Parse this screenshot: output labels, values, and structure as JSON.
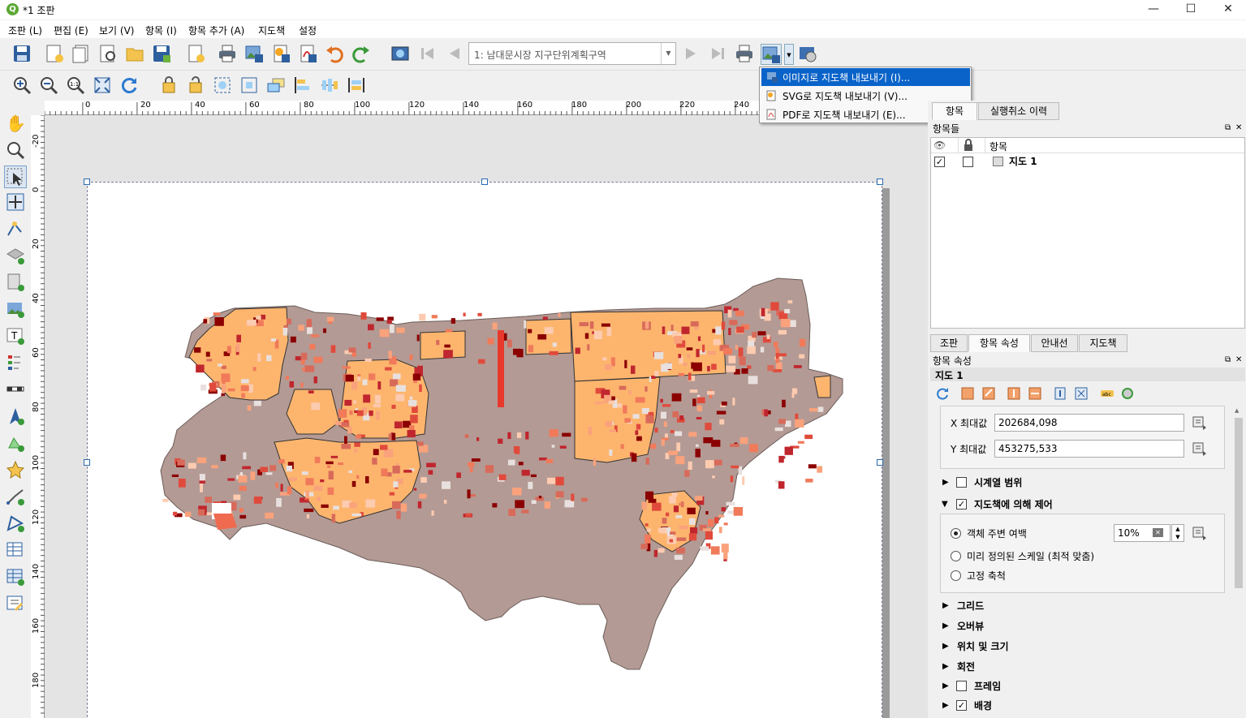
{
  "window": {
    "title": "*1 조판",
    "logo": "Q",
    "minimize": "—",
    "maximize": "☐",
    "close": "✕"
  },
  "menu": [
    "조판 (L)",
    "편집 (E)",
    "보기 (V)",
    "항목 (I)",
    "항목 추가 (A)",
    "지도책",
    "설정"
  ],
  "toolbar": {
    "atlas_combo": "1: 남대문시장  지구단위계획구역"
  },
  "export_menu": {
    "items": [
      {
        "label": "이미지로 지도책 내보내기 (I)...",
        "selected": true
      },
      {
        "label": "SVG로 지도책 내보내기 (V)...",
        "selected": false
      },
      {
        "label": "PDF로 지도책 내보내기 (E)...",
        "selected": false
      }
    ]
  },
  "ruler": {
    "h_ticks": [
      "0",
      "20",
      "40",
      "60",
      "80",
      "100",
      "120",
      "140",
      "160",
      "180",
      "200",
      "220",
      "240"
    ],
    "v_ticks": [
      "-20",
      "0",
      "20",
      "40",
      "60",
      "80",
      "100",
      "120",
      "140",
      "160",
      "180"
    ]
  },
  "right_panel": {
    "top_tabs": [
      "항목",
      "실행취소 이력"
    ],
    "items_title": "항목들",
    "items_header": "항목",
    "items": [
      {
        "label": "지도 1",
        "visible": true,
        "locked": false
      }
    ],
    "bottom_tabs": [
      "조판",
      "항목 속성",
      "안내선",
      "지도책"
    ],
    "props_title": "항목 속성",
    "item_name": "지도 1",
    "x_max_label": "X 최대값",
    "x_max": "202684,098",
    "y_max_label": "Y 최대값",
    "y_max": "453275,533",
    "sections": {
      "temporal": "시계열 범위",
      "atlas_control": "지도책에 의해 제어",
      "margin_label": "객체 주변 여백",
      "margin_value": "10%",
      "predefined_scale": "미리 정의된 스케일 (최적 맞춤)",
      "fixed_scale": "고정 축척",
      "grid": "그리드",
      "overview": "오버뷰",
      "position_size": "위치 및 크기",
      "rotation": "회전",
      "frame": "프레임",
      "background": "배경"
    }
  },
  "colors": {
    "accent": "#0a63c9",
    "map_base": "#b49a94",
    "zone_fill": "#fdb56e",
    "dark_red": "#8b0000"
  }
}
